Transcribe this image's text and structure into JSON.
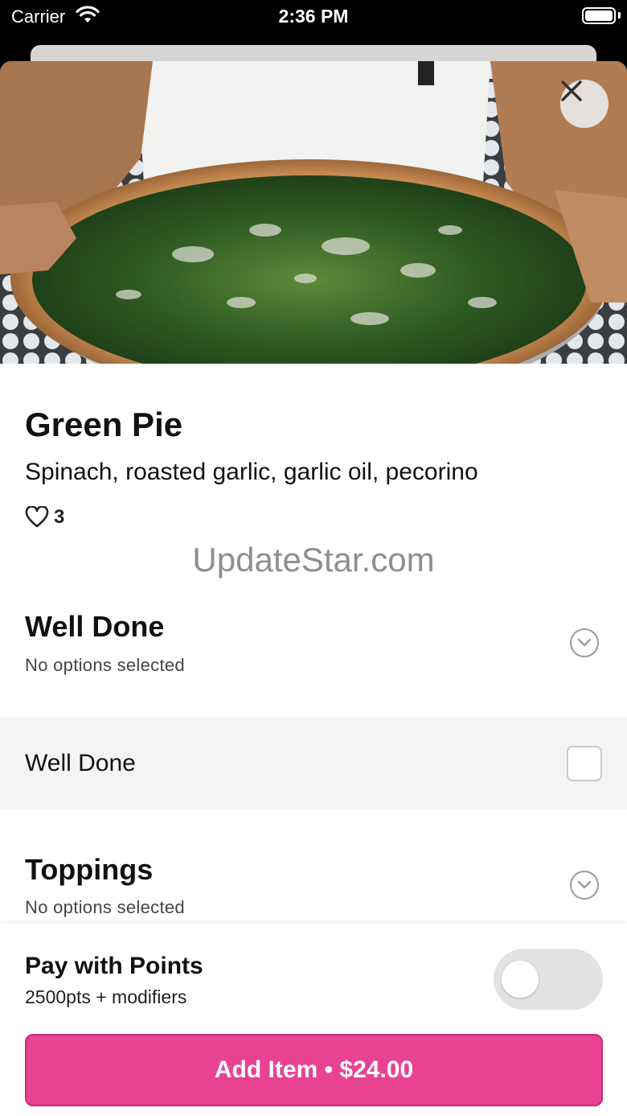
{
  "status_bar": {
    "carrier": "Carrier",
    "time": "2:36 PM",
    "wifi_icon": "wifi-icon",
    "battery_icon": "battery-icon"
  },
  "item": {
    "name": "Green Pie",
    "description": "Spinach, roasted garlic, garlic oil, pecorino",
    "likes": "3",
    "like_icon": "heart-icon",
    "close_icon": "close-icon"
  },
  "watermark": "UpdateStar.com",
  "sections": [
    {
      "title": "Well Done",
      "selection_status": "No options selected",
      "options": [
        {
          "label": "Well Done",
          "checked": false
        }
      ]
    },
    {
      "title": "Toppings",
      "selection_status": "No options selected"
    }
  ],
  "points": {
    "title": "Pay with Points",
    "subtitle": "2500pts + modifiers",
    "enabled": false
  },
  "add_button": {
    "label": "Add Item • $24.00"
  },
  "colors": {
    "accent": "#e84393",
    "toggle_off": "#e2e2e2",
    "option_row_bg": "#f4f4f4"
  }
}
